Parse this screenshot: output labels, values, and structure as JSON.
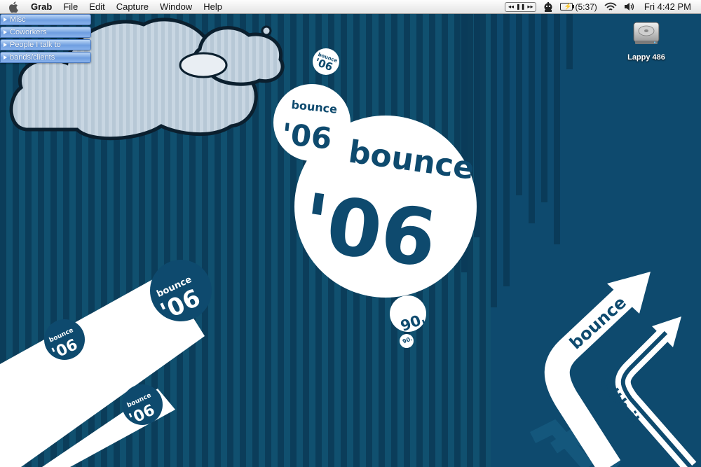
{
  "menubar": {
    "app_name": "Grab",
    "menus": [
      "File",
      "Edit",
      "Capture",
      "Window",
      "Help"
    ],
    "itunes_controls": {
      "prev": "◂◂",
      "pause": "❚❚",
      "next": "▸▸"
    },
    "battery_time": "(5:37)",
    "clock": "Fri 4:42 PM"
  },
  "drawer_tabs": [
    "Misc",
    "Coworkers",
    "People I talk to",
    "bands/clients"
  ],
  "desktop_icon": {
    "label": "Lappy 486",
    "icon": "hard-drive-icon"
  },
  "wallpaper": {
    "text": {
      "bounce": "bounce",
      "year": "'06",
      "with_it": "with it"
    },
    "colors": {
      "background": "#0e4a6e",
      "stripe_dark": "#0a3b59",
      "white": "#ffffff",
      "cloud_fill": "#c8d6e2",
      "cloud_outline": "#0b1f2e"
    }
  }
}
